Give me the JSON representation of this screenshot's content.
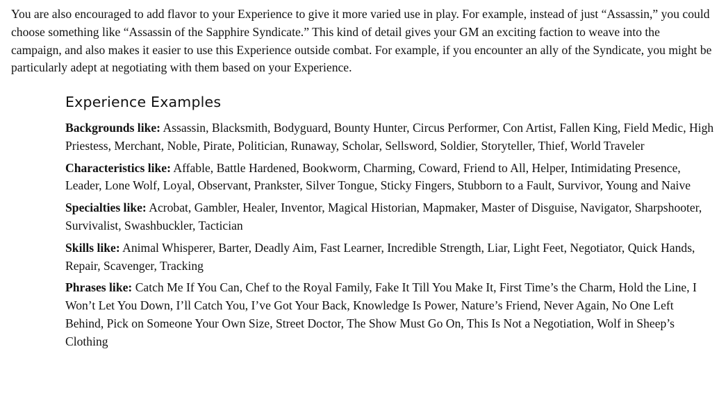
{
  "intro": {
    "text": "You are also encouraged to add flavor to your Experience to give it more varied use in play. For example, instead of just “Assassin,” you could choose something like “Assassin of the Sapphire Syndicate.” This kind of detail gives your GM an exciting faction to weave into the campaign, and also makes it easier to use this Experience outside combat. For example, if you encounter an ally of the Syndicate, you might be particularly adept at negotiating with them based on your Experience."
  },
  "section": {
    "title": "Experience Examples",
    "examples": [
      {
        "label": "Backgrounds like:",
        "text": "Assassin, Blacksmith, Bodyguard, Bounty Hunter, Circus Performer, Con Artist, Fallen King, Field Medic, High Priestess, Merchant, Noble, Pirate, Politician, Runaway, Scholar, Sellsword, Soldier, Storyteller, Thief, World Traveler"
      },
      {
        "label": "Characteristics like:",
        "text": "Affable, Battle Hardened, Bookworm, Charming, Coward, Friend to All, Helper, Intimidating Presence, Leader, Lone Wolf, Loyal, Observant, Prankster, Silver Tongue, Sticky Fingers, Stubborn to a Fault, Survivor, Young and Naive"
      },
      {
        "label": "Specialties like:",
        "text": "Acrobat, Gambler, Healer, Inventor, Magical Historian, Mapmaker, Master of Disguise, Navigator, Sharpshooter, Survivalist, Swashbuckler, Tactician"
      },
      {
        "label": "Skills like:",
        "text": "Animal Whisperer, Barter, Deadly Aim, Fast Learner, Incredible Strength, Liar, Light Feet, Negotiator, Quick Hands, Repair, Scavenger, Tracking"
      },
      {
        "label": "Phrases like:",
        "text": "Catch Me If You Can, Chef to the Royal Family, Fake It Till You Make It, First Time’s the Charm, Hold the Line, I Won’t Let You Down, I’ll Catch You, I’ve Got Your Back, Knowledge Is Power, Nature’s Friend, Never Again, No One Left Behind, Pick on Someone Your Own Size, Street Doctor, The Show Must Go On, This Is Not a Negotiation, Wolf in Sheep’s Clothing"
      }
    ]
  }
}
